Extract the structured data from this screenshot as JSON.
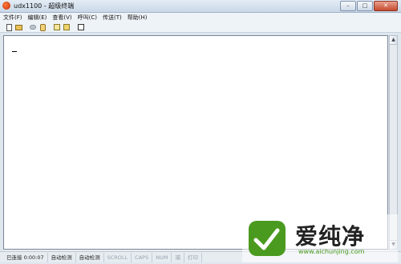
{
  "window": {
    "title": "udx1100 - 超级终端",
    "controls": {
      "minimize": "–",
      "maximize": "□",
      "close": "✕"
    }
  },
  "menu": {
    "items": [
      {
        "label": "文件(F)"
      },
      {
        "label": "编辑(E)"
      },
      {
        "label": "查看(V)"
      },
      {
        "label": "呼叫(C)"
      },
      {
        "label": "传送(T)"
      },
      {
        "label": "帮助(H)"
      }
    ]
  },
  "toolbar": {
    "icons": [
      "new-icon",
      "open-icon",
      "disconnect-icon",
      "dial-icon",
      "send-icon",
      "receive-icon",
      "properties-icon"
    ]
  },
  "terminal": {
    "scroll_up": "▲",
    "scroll_down": "▼"
  },
  "status": {
    "connection": "已连接 0:00:07",
    "detect1": "自动检测",
    "detect2": "自动检测",
    "scroll": "SCROLL",
    "caps": "CAPS",
    "num": "NUM",
    "capture": "捕",
    "print": "打印"
  },
  "watermark": {
    "title": "爱纯净",
    "url": "www.aichunjing.com"
  },
  "colors": {
    "brand_green": "#4a9a1f",
    "titlebar_top": "#e4edf6",
    "titlebar_bottom": "#c9d7e6"
  }
}
